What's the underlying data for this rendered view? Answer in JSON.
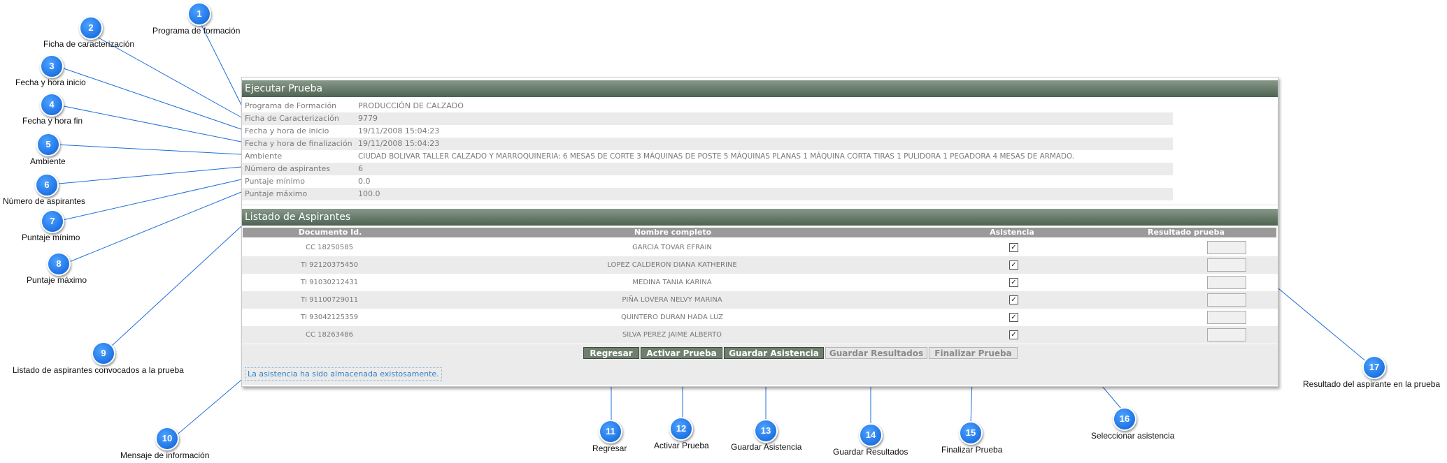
{
  "panel": {
    "ejecutar_title": "Ejecutar Prueba",
    "info": [
      {
        "label": "Programa de Formación",
        "value": "PRODUCCIÓN DE CALZADO"
      },
      {
        "label": "Ficha de Caracterización",
        "value": "9779"
      },
      {
        "label": "Fecha y hora de inicio",
        "value": "19/11/2008 15:04:23"
      },
      {
        "label": "Fecha y hora de finalización",
        "value": "19/11/2008 15:04:23"
      },
      {
        "label": "Ambiente",
        "value": "CIUDAD BOLIVAR TALLER CALZADO Y MARROQUINERIA: 6 MESAS DE CORTE 3 MÁQUINAS DE POSTE 5 MÁQUINAS PLANAS 1 MÁQUINA CORTA TIRAS 1 PULIDORA 1 PEGADORA 4 MESAS DE ARMADO."
      },
      {
        "label": "Número de aspirantes",
        "value": "6"
      },
      {
        "label": "Puntaje mínimo",
        "value": "0.0"
      },
      {
        "label": "Puntaje máximo",
        "value": "100.0"
      }
    ],
    "listado_title": "Listado de Aspirantes",
    "columns": [
      "Documento Id.",
      "Nombre completo",
      "Asistencia",
      "Resultado prueba"
    ],
    "rows": [
      {
        "doc": "CC 18250585",
        "name": "GARCIA TOVAR EFRAIN",
        "check": "✓"
      },
      {
        "doc": "TI 92120375450",
        "name": "LOPEZ CALDERON DIANA KATHERINE",
        "check": "✓"
      },
      {
        "doc": "TI 91030212431",
        "name": "MEDINA TANIA KARINA",
        "check": "✓"
      },
      {
        "doc": "TI 91100729011",
        "name": "PIÑA LOVERA NELVY MARINA",
        "check": "✓"
      },
      {
        "doc": "TI 93042125359",
        "name": "QUINTERO DURAN HADA LUZ",
        "check": "✓"
      },
      {
        "doc": "CC 18263486",
        "name": "SILVA PEREZ JAIME ALBERTO",
        "check": "✓"
      }
    ],
    "buttons": {
      "regresar": "Regresar",
      "activar": "Activar Prueba",
      "guardar_asistencia": "Guardar Asistencia",
      "guardar_resultados": "Guardar Resultados",
      "finalizar": "Finalizar Prueba"
    },
    "message": "La asistencia ha sido almacenada existosamente."
  },
  "callouts": [
    {
      "num": "1",
      "label": "Programa de formación"
    },
    {
      "num": "2",
      "label": "Ficha de caracterización"
    },
    {
      "num": "3",
      "label": "Fecha y hora inicio"
    },
    {
      "num": "4",
      "label": "Fecha y hora fin"
    },
    {
      "num": "5",
      "label": "Ambiente"
    },
    {
      "num": "6",
      "label": "Número de aspirantes"
    },
    {
      "num": "7",
      "label": "Puntaje mínimo"
    },
    {
      "num": "8",
      "label": "Puntaje máximo"
    },
    {
      "num": "9",
      "label": "Listado de aspirantes convocados a la prueba"
    },
    {
      "num": "10",
      "label": "Mensaje de información"
    },
    {
      "num": "11",
      "label": "Regresar"
    },
    {
      "num": "12",
      "label": "Activar Prueba"
    },
    {
      "num": "13",
      "label": "Guardar Asistencia"
    },
    {
      "num": "14",
      "label": "Guardar Resultados"
    },
    {
      "num": "15",
      "label": "Finalizar Prueba"
    },
    {
      "num": "16",
      "label": "Seleccionar asistencia"
    },
    {
      "num": "17",
      "label": "Resultado del aspirante en la prueba"
    }
  ],
  "colors": {
    "marker": "#1a73e8",
    "header": "#5c7060",
    "line": "#1e6fd9"
  }
}
